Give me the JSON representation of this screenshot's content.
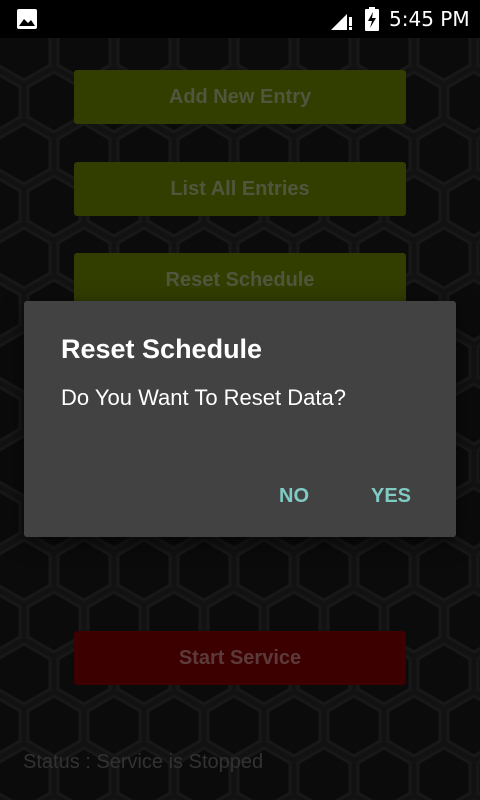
{
  "status_bar": {
    "time": "5:45 PM",
    "icons": [
      "image-icon",
      "signal-icon",
      "battery-charging-icon"
    ]
  },
  "buttons": {
    "add_new_entry": "Add New Entry",
    "list_all_entries": "List All Entries",
    "reset_schedule": "Reset Schedule",
    "start_service": "Start Service"
  },
  "status": {
    "text": "Status : Service is Stopped"
  },
  "dialog": {
    "title": "Reset Schedule",
    "message": "Do You Want To Reset Data?",
    "negative": "NO",
    "positive": "YES"
  },
  "colors": {
    "green_button": "#4e5e00",
    "red_button": "#5e0000",
    "dialog_background": "#424242",
    "dialog_action": "#80cbc4"
  }
}
